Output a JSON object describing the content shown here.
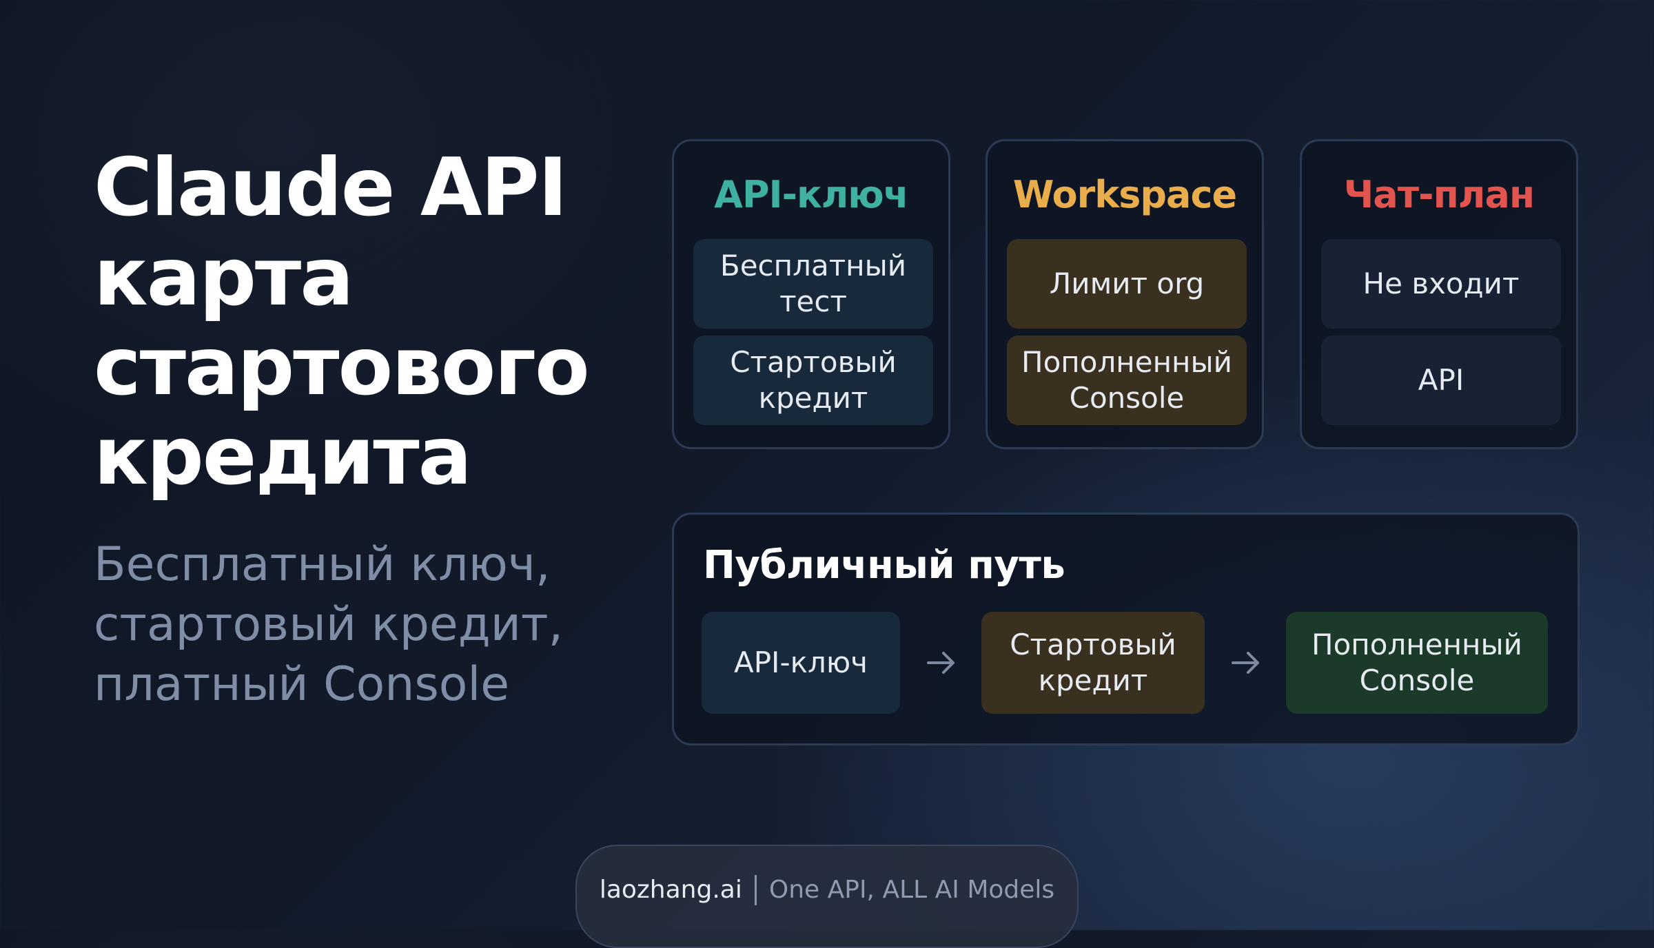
{
  "title": {
    "lines": [
      "Claude API",
      "карта",
      "стартового",
      "кредита"
    ]
  },
  "subtitle": {
    "lines": [
      "Бесплатный ключ,",
      "стартовый кредит,",
      "платный Console"
    ]
  },
  "cards": [
    {
      "title": "API-ключ",
      "title_color": "#3fb1a0",
      "items": [
        {
          "lines": [
            "Бесплатный",
            "тест"
          ]
        },
        {
          "lines": [
            "Стартовый",
            "кредит"
          ]
        }
      ]
    },
    {
      "title": "Workspace",
      "title_color": "#e9ad4c",
      "items": [
        {
          "lines": [
            "Лимит org"
          ]
        },
        {
          "lines": [
            "Пополненный",
            "Console"
          ]
        }
      ]
    },
    {
      "title": "Чат-план",
      "title_color": "#e2544d",
      "items": [
        {
          "lines": [
            "Не входит"
          ]
        },
        {
          "lines": [
            "API"
          ]
        }
      ]
    }
  ],
  "public_path": {
    "title": "Публичный путь",
    "steps": [
      {
        "lines": [
          "API-ключ"
        ]
      },
      {
        "lines": [
          "Стартовый",
          "кредит"
        ]
      },
      {
        "lines": [
          "Пополненный",
          "Console"
        ]
      }
    ],
    "arrow_icon": "arrow-right-icon"
  },
  "footer": {
    "brand": "laozhang.ai",
    "tagline": "One API, ALL AI Models"
  },
  "colors": {
    "teal": "#3fb1a0",
    "amber": "#e9ad4c",
    "red": "#e2544d",
    "chip_teal": "#17293a",
    "chip_amber": "#3a301f",
    "chip_green": "#1b3a2a"
  }
}
